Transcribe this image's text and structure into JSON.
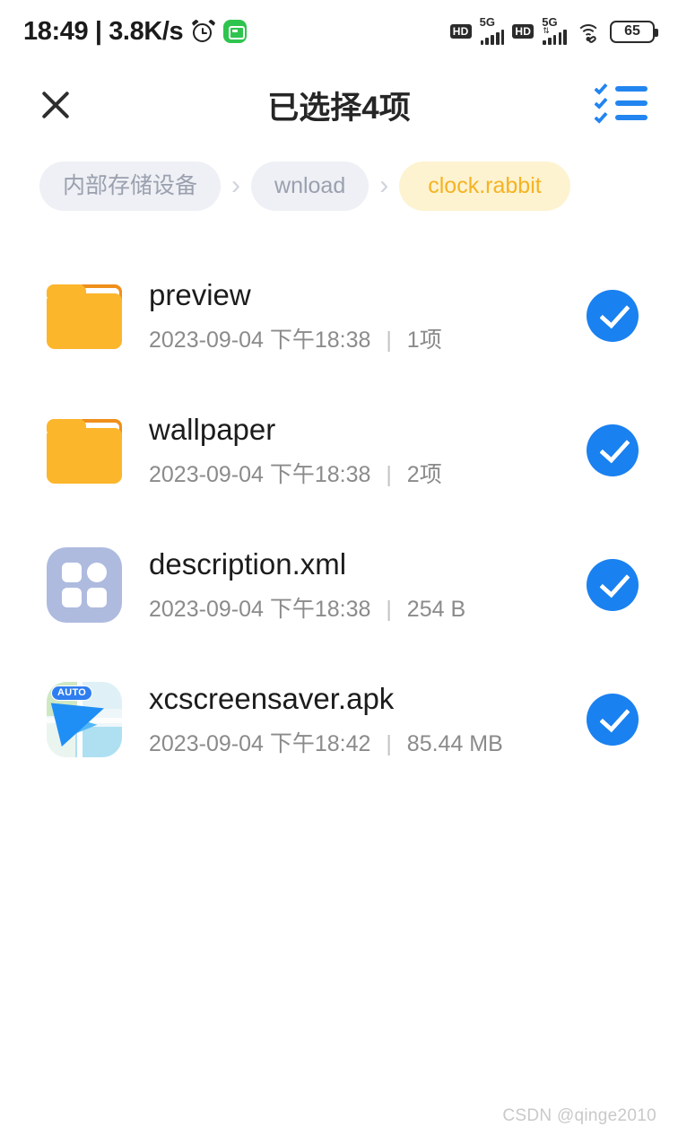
{
  "status_bar": {
    "time": "18:49",
    "separator": "|",
    "net_speed": "3.8K/s",
    "alarm_icon": "alarm-clock-icon",
    "app_badge_icon": "green-app-badge-icon",
    "hd_label_1": "HD",
    "network_label_1": "5G",
    "hd_label_2": "HD",
    "network_label_2": "5G",
    "data_arrows": "⇅",
    "wifi_icon": "wifi-icon",
    "wifi_link_icon": "link-icon",
    "battery_level": "65"
  },
  "app_bar": {
    "close_icon": "close-icon",
    "title": "已选择4项",
    "select_all_icon": "select-all-checklist-icon"
  },
  "breadcrumb": {
    "separator": "›",
    "items": [
      {
        "label": "内部存储设备",
        "state": "muted"
      },
      {
        "label": "wnload",
        "state": "muted"
      },
      {
        "label": "clock.rabbit",
        "state": "active"
      }
    ]
  },
  "file_list": [
    {
      "name": "preview",
      "date": "2023-09-04 下午18:38",
      "divider": "|",
      "size": "1项",
      "icon": "folder-icon",
      "selected": true
    },
    {
      "name": "wallpaper",
      "date": "2023-09-04 下午18:38",
      "divider": "|",
      "size": "2项",
      "icon": "folder-icon",
      "selected": true
    },
    {
      "name": "description.xml",
      "date": "2023-09-04 下午18:38",
      "divider": "|",
      "size": "254 B",
      "icon": "xml-file-icon",
      "selected": true
    },
    {
      "name": "xcscreensaver.apk",
      "date": "2023-09-04 下午18:42",
      "divider": "|",
      "size": "85.44 MB",
      "icon": "apk-file-icon",
      "apk_badge": "AUTO",
      "selected": true
    }
  ],
  "watermark": "CSDN @qinge2010",
  "colors": {
    "accent_blue": "#1a81f0",
    "folder_amber": "#fcb62c",
    "folder_tab": "#ef8f1c",
    "crumb_active_bg": "#fdf3d0",
    "crumb_active_text": "#f5b324",
    "crumb_muted_bg": "#eef0f5",
    "crumb_muted_text": "#9aa0ae",
    "xml_icon_bg": "#aebbdf",
    "title_text": "#262626",
    "subtitle_text": "#8b8b8b"
  }
}
